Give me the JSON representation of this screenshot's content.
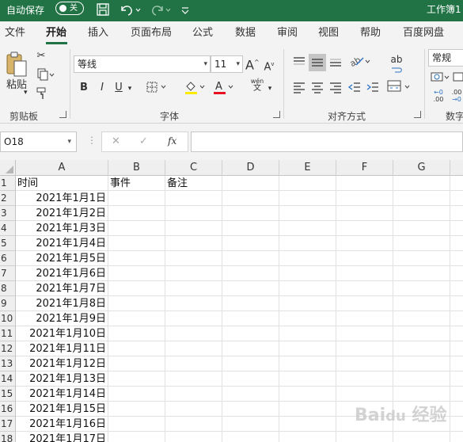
{
  "titlebar": {
    "autosave_label": "自动保存",
    "autosave_state": "关",
    "doc_title": "工作簿1"
  },
  "tabs": [
    "文件",
    "开始",
    "插入",
    "页面布局",
    "公式",
    "数据",
    "审阅",
    "视图",
    "帮助",
    "百度网盘"
  ],
  "active_tab": "开始",
  "ribbon": {
    "paste_label": "粘贴",
    "clipboard_label": "剪贴板",
    "font_name": "等线",
    "font_size": "11",
    "font_group_label": "字体",
    "bold": "B",
    "italic": "I",
    "underline": "U",
    "phonetic_top": "wén",
    "phonetic_bottom": "文",
    "align_group_label": "对齐方式",
    "number_format": "常规",
    "number_group_label": "数字",
    "grow_font": "A",
    "shrink_font": "A",
    "decrease_decimal_top": "←0",
    "decrease_decimal_bottom": ".00",
    "increase_decimal_top": ".00",
    "increase_decimal_bottom": "→0",
    "wrap_text": "ab",
    "accent_color": "#217346",
    "fill_color": "#ffeb00",
    "font_color": "#e81123"
  },
  "formula_bar": {
    "name_box": "O18",
    "cancel": "✕",
    "enter": "✓",
    "fx": "fx",
    "formula": ""
  },
  "grid": {
    "columns": [
      "A",
      "B",
      "C",
      "D",
      "E",
      "F",
      "G"
    ],
    "rows": [
      "1",
      "2",
      "3",
      "4",
      "5",
      "6",
      "7",
      "8",
      "9",
      "10",
      "11",
      "12",
      "13",
      "14",
      "15",
      "16",
      "17",
      "18"
    ],
    "cells": {
      "A1": "时间",
      "B1": "事件",
      "C1": "备注",
      "A": [
        "2021年1月1日",
        "2021年1月2日",
        "2021年1月3日",
        "2021年1月4日",
        "2021年1月5日",
        "2021年1月6日",
        "2021年1月7日",
        "2021年1月8日",
        "2021年1月9日",
        "2021年1月10日",
        "2021年1月11日",
        "2021年1月12日",
        "2021年1月13日",
        "2021年1月14日",
        "2021年1月15日",
        "2021年1月16日",
        "2021年1月17日"
      ]
    }
  }
}
